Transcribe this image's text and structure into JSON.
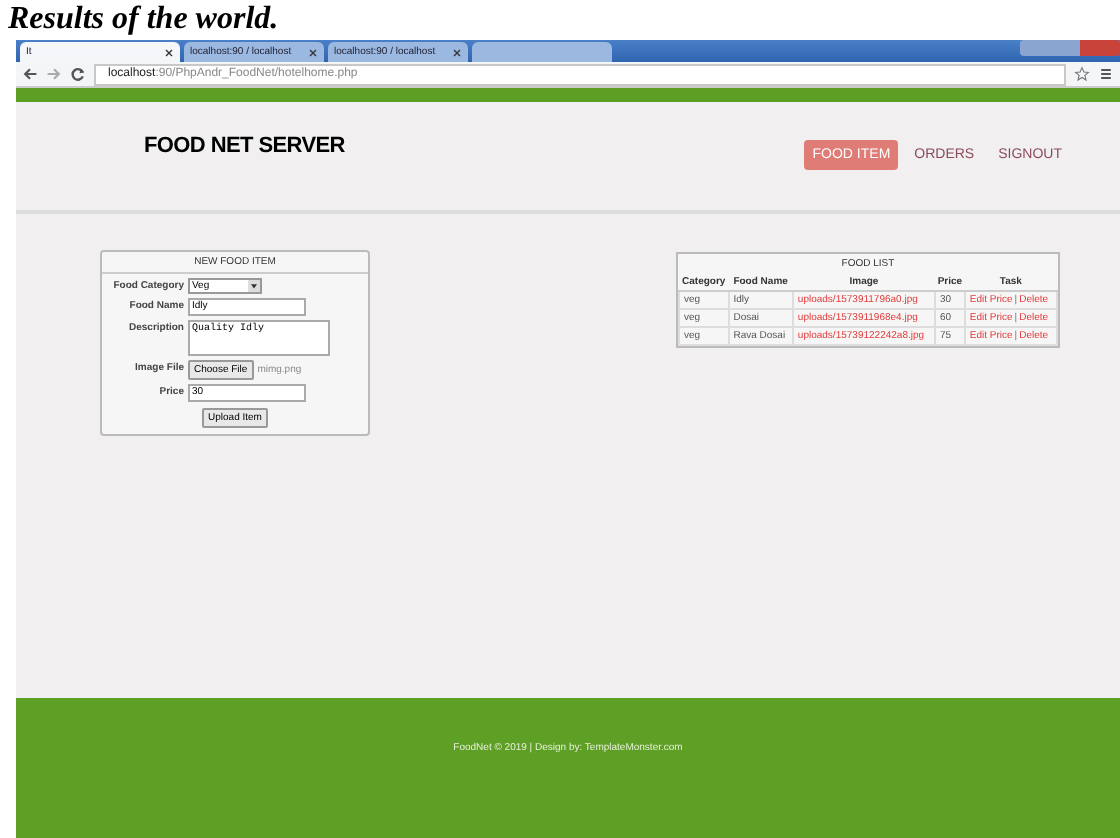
{
  "caption": "Results of the world.",
  "browser": {
    "tabs": [
      {
        "label": "It",
        "selected": true
      },
      {
        "label": "localhost:90 / localhost",
        "selected": false
      },
      {
        "label": "localhost:90 / localhost",
        "selected": false
      },
      {
        "selected": false
      }
    ],
    "url_host": "localhost",
    "url_rest": ":90/PhpAndr_FoodNet/hotelhome.php"
  },
  "header": {
    "logo": "FOOD NET SERVER",
    "nav": [
      {
        "label": "FOOD ITEM",
        "selected": true
      },
      {
        "label": "ORDERS",
        "selected": false
      },
      {
        "label": "SIGNOUT",
        "selected": false
      }
    ]
  },
  "form": {
    "title": "NEW FOOD ITEM",
    "fields": [
      {
        "kind": "select",
        "label": "Food Category",
        "value": "Veg"
      },
      {
        "kind": "text",
        "label": "Food Name",
        "value": "Idly"
      },
      {
        "kind": "textarea",
        "label": "Description",
        "value": "Quality Idly"
      },
      {
        "kind": "file",
        "label": "Image File",
        "button": "Choose File",
        "value": "mimg.png"
      },
      {
        "kind": "text",
        "label": "Price",
        "value": "30"
      }
    ],
    "submit": "Upload Item"
  },
  "table": {
    "title": "FOOD LIST",
    "columns": [
      "Category",
      "Food Name",
      "Image",
      "Price",
      "Task"
    ],
    "rows": [
      {
        "category": "veg",
        "name": "Idly",
        "image": "uploads/1573911796a0.jpg",
        "price": "30",
        "edit": "Edit Price",
        "sep": "|",
        "delete": "Delete"
      },
      {
        "category": "veg",
        "name": "Dosai",
        "image": "uploads/1573911968e4.jpg",
        "price": "60",
        "edit": "Edit Price",
        "sep": "|",
        "delete": "Delete"
      },
      {
        "category": "veg",
        "name": "Rava Dosai",
        "image": "uploads/15739122242a8.jpg",
        "price": "75",
        "edit": "Edit Price",
        "sep": "|",
        "delete": "Delete"
      }
    ]
  },
  "footer": "FoodNet © 2019 | Design by: TemplateMonster.com"
}
